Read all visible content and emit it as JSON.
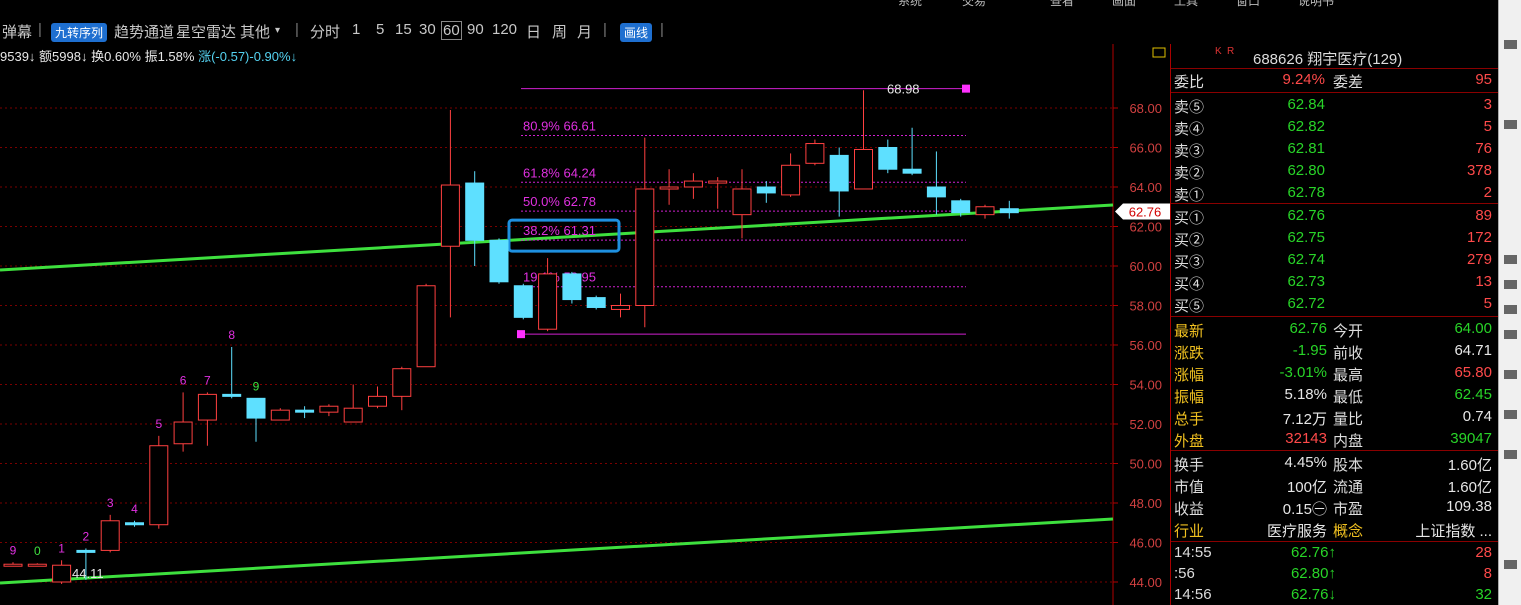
{
  "menu": [
    "系统",
    "交易",
    "查看",
    "画面",
    "工具",
    "窗口",
    "说明书"
  ],
  "toolbar": {
    "first": "弹幕",
    "indicator": "九转序列",
    "items": [
      "趋势通道",
      "星空雷达",
      "其他"
    ],
    "periods": [
      "分时",
      "1",
      "5",
      "15",
      "30",
      "60",
      "90",
      "120",
      "日",
      "周",
      "月"
    ],
    "selected_period": "60",
    "draw_btn": "画线"
  },
  "info": {
    "a": "9539↓",
    "b": "额5998↓",
    "c": "换0.60%",
    "d": "振1.58%",
    "e": "涨(-0.57)-0.90%↓"
  },
  "chart_data": {
    "type": "candlestick",
    "ylim": [
      43.5,
      70.5
    ],
    "yticks": [
      "44.00",
      "46.00",
      "48.00",
      "50.00",
      "52.00",
      "54.00",
      "56.00",
      "58.00",
      "60.00",
      "62.00",
      "64.00",
      "66.00",
      "68.00"
    ],
    "current_price": "62.76",
    "candles": [
      {
        "o": 44.9,
        "c": 44.9,
        "h": 45.0,
        "l": 44.8,
        "label": "9"
      },
      {
        "o": 44.9,
        "c": 44.9,
        "h": 44.95,
        "l": 44.85,
        "label": "0"
      },
      {
        "o": 44.0,
        "c": 44.85,
        "h": 45.1,
        "l": 43.9,
        "label": "1"
      },
      {
        "o": 45.6,
        "c": 45.5,
        "h": 45.7,
        "l": 44.11,
        "label": "2"
      },
      {
        "o": 45.6,
        "c": 47.1,
        "h": 47.4,
        "l": 45.5,
        "label": "3"
      },
      {
        "o": 47.0,
        "c": 46.9,
        "h": 47.1,
        "l": 46.8,
        "label": "4"
      },
      {
        "o": 46.9,
        "c": 50.9,
        "h": 51.4,
        "l": 46.7,
        "label": "5"
      },
      {
        "o": 51.0,
        "c": 52.1,
        "h": 53.6,
        "l": 50.6,
        "label": "6"
      },
      {
        "o": 52.2,
        "c": 53.5,
        "h": 53.6,
        "l": 50.9,
        "label": "7"
      },
      {
        "o": 53.5,
        "c": 53.4,
        "h": 55.9,
        "l": 53.3,
        "label": "8"
      },
      {
        "o": 53.3,
        "c": 52.3,
        "h": 53.3,
        "l": 51.1,
        "label": "9"
      },
      {
        "o": 52.2,
        "c": 52.7,
        "h": 52.8,
        "l": 52.2,
        "label": ""
      },
      {
        "o": 52.7,
        "c": 52.6,
        "h": 52.9,
        "l": 52.3,
        "label": ""
      },
      {
        "o": 52.6,
        "c": 52.9,
        "h": 53.0,
        "l": 52.4,
        "label": ""
      },
      {
        "o": 52.1,
        "c": 52.8,
        "h": 54.0,
        "l": 52.1,
        "label": ""
      },
      {
        "o": 52.9,
        "c": 53.4,
        "h": 53.9,
        "l": 52.8,
        "label": ""
      },
      {
        "o": 53.4,
        "c": 54.8,
        "h": 54.9,
        "l": 52.7,
        "label": ""
      },
      {
        "o": 54.9,
        "c": 59.0,
        "h": 59.1,
        "l": 54.9,
        "label": ""
      },
      {
        "o": 61.0,
        "c": 64.1,
        "h": 67.9,
        "l": 57.4,
        "label": ""
      },
      {
        "o": 64.2,
        "c": 61.3,
        "h": 64.8,
        "l": 60.0,
        "label": ""
      },
      {
        "o": 61.3,
        "c": 59.2,
        "h": 61.4,
        "l": 59.1,
        "label": ""
      },
      {
        "o": 59.0,
        "c": 57.4,
        "h": 59.1,
        "l": 57.3,
        "label": ""
      },
      {
        "o": 56.8,
        "c": 59.6,
        "h": 60.4,
        "l": 56.7,
        "label": ""
      },
      {
        "o": 59.6,
        "c": 58.3,
        "h": 59.7,
        "l": 58.1,
        "label": ""
      },
      {
        "o": 58.4,
        "c": 57.9,
        "h": 58.5,
        "l": 57.8,
        "label": ""
      },
      {
        "o": 57.8,
        "c": 58.0,
        "h": 58.6,
        "l": 57.4,
        "label": ""
      },
      {
        "o": 58.0,
        "c": 63.9,
        "h": 66.5,
        "l": 56.9,
        "label": ""
      },
      {
        "o": 64.0,
        "c": 64.0,
        "h": 64.9,
        "l": 63.1,
        "label": ""
      },
      {
        "o": 64.0,
        "c": 64.3,
        "h": 64.7,
        "l": 63.4,
        "label": ""
      },
      {
        "o": 64.2,
        "c": 64.3,
        "h": 64.5,
        "l": 62.9,
        "label": ""
      },
      {
        "o": 62.6,
        "c": 63.9,
        "h": 64.9,
        "l": 61.4,
        "label": ""
      },
      {
        "o": 64.0,
        "c": 63.7,
        "h": 64.3,
        "l": 63.2,
        "label": ""
      },
      {
        "o": 63.6,
        "c": 65.1,
        "h": 65.7,
        "l": 63.5,
        "label": ""
      },
      {
        "o": 65.2,
        "c": 66.2,
        "h": 66.4,
        "l": 65.1,
        "label": ""
      },
      {
        "o": 65.6,
        "c": 63.8,
        "h": 66.0,
        "l": 62.5,
        "label": ""
      },
      {
        "o": 63.9,
        "c": 65.9,
        "h": 68.9,
        "l": 63.9,
        "label": ""
      },
      {
        "o": 66.0,
        "c": 64.9,
        "h": 66.4,
        "l": 64.7,
        "label": ""
      },
      {
        "o": 64.9,
        "c": 64.7,
        "h": 67.0,
        "l": 64.6,
        "label": ""
      },
      {
        "o": 64.0,
        "c": 63.5,
        "h": 65.8,
        "l": 62.6,
        "label": ""
      },
      {
        "o": 63.3,
        "c": 62.7,
        "h": 63.4,
        "l": 62.5,
        "label": ""
      },
      {
        "o": 62.6,
        "c": 63.0,
        "h": 63.1,
        "l": 62.4,
        "label": ""
      },
      {
        "o": 62.9,
        "c": 62.7,
        "h": 63.3,
        "l": 62.4,
        "label": ""
      }
    ],
    "low_label": "44.11",
    "fib_top": "68.98",
    "fib_levels": [
      {
        "label": "80.9% 66.61",
        "v": 66.61
      },
      {
        "label": "61.8% 64.24",
        "v": 64.24
      },
      {
        "label": "50.0% 62.78",
        "v": 62.78
      },
      {
        "label": "38.2% 61.31",
        "v": 61.31
      },
      {
        "label": "19.1% 58.95",
        "v": 58.95
      }
    ],
    "fib_high": 68.98,
    "fib_low": 56.55
  },
  "quote": {
    "code": "688626",
    "name": "翔宇医疗(129)",
    "k": "K",
    "r": "R",
    "wei_bi_label": "委比",
    "wei_bi": "9.24%",
    "wei_cha_label": "委差",
    "wei_cha": "95",
    "sells": [
      {
        "label": "卖⑤",
        "price": "62.84",
        "vol": "3"
      },
      {
        "label": "卖④",
        "price": "62.82",
        "vol": "5"
      },
      {
        "label": "卖③",
        "price": "62.81",
        "vol": "76"
      },
      {
        "label": "卖②",
        "price": "62.80",
        "vol": "378"
      },
      {
        "label": "卖①",
        "price": "62.78",
        "vol": "2"
      }
    ],
    "buys": [
      {
        "label": "买①",
        "price": "62.76",
        "vol": "89"
      },
      {
        "label": "买②",
        "price": "62.75",
        "vol": "172"
      },
      {
        "label": "买③",
        "price": "62.74",
        "vol": "279"
      },
      {
        "label": "买④",
        "price": "62.73",
        "vol": "13"
      },
      {
        "label": "买⑤",
        "price": "62.72",
        "vol": "5"
      }
    ],
    "stats": [
      {
        "l1": "最新",
        "v1": "62.76",
        "c1": "grn",
        "l2": "今开",
        "v2": "64.00",
        "c2": "grn"
      },
      {
        "l1": "涨跌",
        "v1": "-1.95",
        "c1": "grn",
        "l2": "前收",
        "v2": "64.71",
        "c2": "wht"
      },
      {
        "l1": "涨幅",
        "v1": "-3.01%",
        "c1": "grn",
        "l2": "最高",
        "v2": "65.80",
        "c2": "red"
      },
      {
        "l1": "振幅",
        "v1": "5.18%",
        "c1": "wht",
        "l2": "最低",
        "v2": "62.45",
        "c2": "grn"
      },
      {
        "l1": "总手",
        "v1": "7.12万",
        "c1": "wht",
        "l2": "量比",
        "v2": "0.74",
        "c2": "wht"
      },
      {
        "l1": "外盘",
        "v1": "32143",
        "c1": "red",
        "l2": "内盘",
        "v2": "39047",
        "c2": "grn"
      }
    ],
    "fund": [
      {
        "l1": "换手",
        "v1": "4.45%",
        "l2": "股本",
        "v2": "1.60亿"
      },
      {
        "l1": "市值",
        "v1": "100亿",
        "l2": "流通",
        "v2": "1.60亿"
      },
      {
        "l1": "收益",
        "v1": "0.15㊀",
        "l2": "市盈",
        "v2": "109.38"
      }
    ],
    "industry_label": "行业",
    "industry": "医疗服务",
    "concept_label": "概念",
    "concept": "上证指数 ...",
    "ticks": [
      {
        "t": "14:55",
        "p": "62.76↑",
        "v": "28"
      },
      {
        "t": ":56",
        "p": "62.80↑",
        "v": "8"
      },
      {
        "t": "14:56",
        "p": "62.76↓",
        "v": "32"
      }
    ]
  }
}
